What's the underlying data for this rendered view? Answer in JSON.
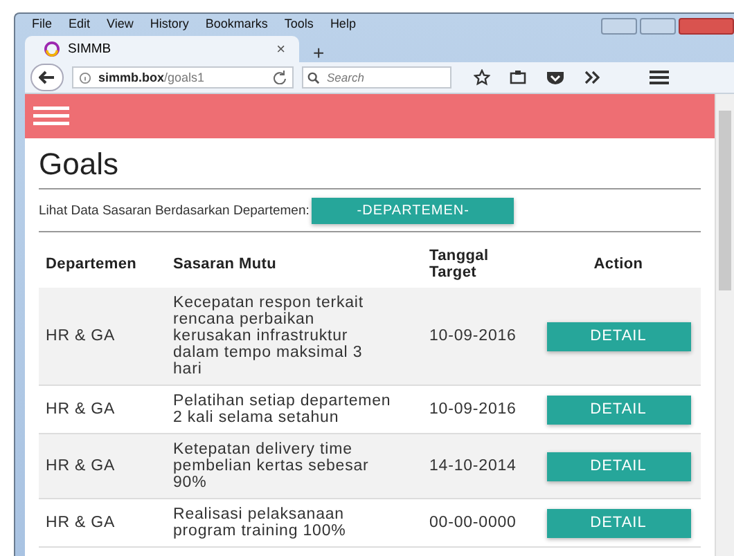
{
  "browser": {
    "menu": [
      "File",
      "Edit",
      "View",
      "History",
      "Bookmarks",
      "Tools",
      "Help"
    ],
    "tab": {
      "title": "SIMMB",
      "close": "×",
      "new_tab": "+"
    },
    "address": {
      "domain": "simmb.box",
      "path": "/goals1"
    },
    "search": {
      "placeholder": "Search"
    }
  },
  "page": {
    "title": "Goals",
    "filter_label": "Lihat Data Sasaran Berdasarkan Departemen:",
    "filter_button": "-DEPARTEMEN-",
    "columns": [
      "Departemen",
      "Sasaran Mutu",
      "Tanggal Target",
      "Action"
    ],
    "rows": [
      {
        "departemen": "HR & GA",
        "sasaran": "Kecepatan respon terkait rencana perbaikan kerusakan infrastruktur dalam tempo maksimal 3 hari",
        "tanggal": "10-09-2016",
        "action": "DETAIL"
      },
      {
        "departemen": "HR & GA",
        "sasaran": "Pelatihan setiap departemen 2 kali selama setahun",
        "tanggal": "10-09-2016",
        "action": "DETAIL"
      },
      {
        "departemen": "HR & GA",
        "sasaran": "Ketepatan delivery time pembelian kertas sebesar 90%",
        "tanggal": "14-10-2014",
        "action": "DETAIL"
      },
      {
        "departemen": "HR & GA",
        "sasaran": "Realisasi pelaksanaan program training 100%",
        "tanggal": "00-00-0000",
        "action": "DETAIL"
      }
    ]
  }
}
